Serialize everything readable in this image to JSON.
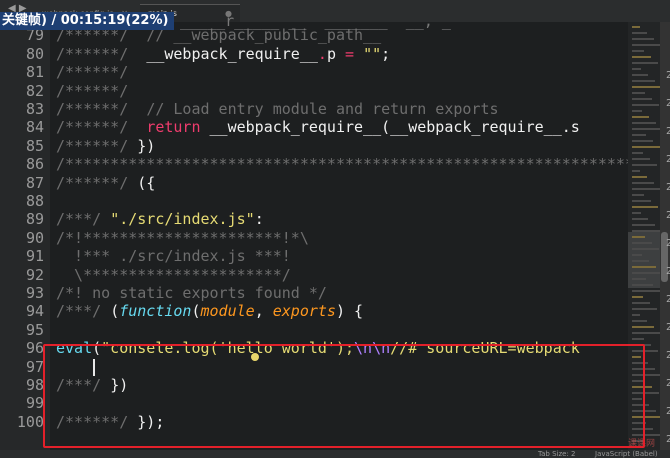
{
  "tabs": [
    {
      "label": "webpack.config.js",
      "active": false
    },
    {
      "label": "main.js",
      "active": true
    }
  ],
  "nav_arrows": "◀ ▶",
  "overlay": {
    "text": "关键帧) / 00:15:19(22%)",
    "ghost": "_____r_____ __  _______  __, _"
  },
  "lines": [
    {
      "n": "78",
      "segs": [
        {
          "t": "/******/",
          "c": "c-comment"
        }
      ]
    },
    {
      "n": "79",
      "segs": [
        {
          "t": "/******/  ",
          "c": "c-comment"
        },
        {
          "t": "// __webpack_public_path__",
          "c": "c-comment"
        }
      ]
    },
    {
      "n": "80",
      "segs": [
        {
          "t": "/******/  ",
          "c": "c-comment"
        },
        {
          "t": "__webpack_require__",
          "c": "c-white"
        },
        {
          "t": ".",
          "c": "c-kw"
        },
        {
          "t": "p ",
          "c": "c-white"
        },
        {
          "t": "=",
          "c": "c-kw"
        },
        {
          "t": " ",
          "c": "c-white"
        },
        {
          "t": "\"\"",
          "c": "c-str"
        },
        {
          "t": ";",
          "c": "c-white"
        }
      ]
    },
    {
      "n": "81",
      "segs": [
        {
          "t": "/******/",
          "c": "c-comment"
        }
      ]
    },
    {
      "n": "82",
      "segs": [
        {
          "t": "/******/",
          "c": "c-comment"
        }
      ]
    },
    {
      "n": "83",
      "segs": [
        {
          "t": "/******/  ",
          "c": "c-comment"
        },
        {
          "t": "// Load entry module and return exports",
          "c": "c-comment"
        }
      ]
    },
    {
      "n": "84",
      "segs": [
        {
          "t": "/******/  ",
          "c": "c-comment"
        },
        {
          "t": "return",
          "c": "c-kw"
        },
        {
          "t": " __webpack_require__(__webpack_require__.s",
          "c": "c-white"
        }
      ]
    },
    {
      "n": "85",
      "segs": [
        {
          "t": "/******/ ",
          "c": "c-comment"
        },
        {
          "t": "})",
          "c": "c-white"
        }
      ]
    },
    {
      "n": "86",
      "segs": [
        {
          "t": "/************************************************************************",
          "c": "c-comment"
        }
      ]
    },
    {
      "n": "87",
      "segs": [
        {
          "t": "/******/ ",
          "c": "c-comment"
        },
        {
          "t": "({",
          "c": "c-white"
        }
      ]
    },
    {
      "n": "88",
      "segs": []
    },
    {
      "n": "89",
      "segs": [
        {
          "t": "/***/ ",
          "c": "c-comment"
        },
        {
          "t": "\"./src/index.js\"",
          "c": "c-str"
        },
        {
          "t": ":",
          "c": "c-white"
        }
      ]
    },
    {
      "n": "90",
      "segs": [
        {
          "t": "/*!**********************!*\\",
          "c": "c-comment"
        }
      ]
    },
    {
      "n": "91",
      "segs": [
        {
          "t": "  !*** ./src/index.js ***!",
          "c": "c-comment"
        }
      ]
    },
    {
      "n": "92",
      "segs": [
        {
          "t": "  \\**********************/",
          "c": "c-comment"
        }
      ]
    },
    {
      "n": "93",
      "segs": [
        {
          "t": "/*! no static exports found */",
          "c": "c-comment"
        }
      ]
    },
    {
      "n": "94",
      "segs": [
        {
          "t": "/***/ ",
          "c": "c-comment"
        },
        {
          "t": "(",
          "c": "c-white"
        },
        {
          "t": "function",
          "c": "c-italic-blue"
        },
        {
          "t": "(",
          "c": "c-white"
        },
        {
          "t": "module",
          "c": "c-param"
        },
        {
          "t": ", ",
          "c": "c-white"
        },
        {
          "t": "exports",
          "c": "c-param"
        },
        {
          "t": ") {",
          "c": "c-white"
        }
      ]
    },
    {
      "n": "95",
      "segs": []
    },
    {
      "n": "96",
      "segs": [
        {
          "t": "eval",
          "c": "c-fn"
        },
        {
          "t": "(",
          "c": "c-white"
        },
        {
          "t": "\"consele.log('hello world');",
          "c": "c-str"
        },
        {
          "t": "\\n\\n",
          "c": "c-esc"
        },
        {
          "t": "//# sourceURL=webpack",
          "c": "c-str"
        }
      ]
    },
    {
      "n": "97",
      "segs": []
    },
    {
      "n": "98",
      "segs": [
        {
          "t": "/***/ ",
          "c": "c-comment"
        },
        {
          "t": "})",
          "c": "c-white"
        }
      ]
    },
    {
      "n": "99",
      "segs": []
    },
    {
      "n": "100",
      "segs": [
        {
          "t": "/******/ ",
          "c": "c-comment"
        },
        {
          "t": "});",
          "c": "c-white"
        }
      ]
    }
  ],
  "right_numbers": [
    "2",
    "2",
    "2",
    "2",
    "2",
    "2",
    "2",
    "2",
    "2",
    "2",
    "2",
    "2",
    "2",
    "2"
  ],
  "status": {
    "tab_size": "Tab Size: 2",
    "syntax": "JavaScript (Babel)"
  },
  "watermark": "课课网"
}
